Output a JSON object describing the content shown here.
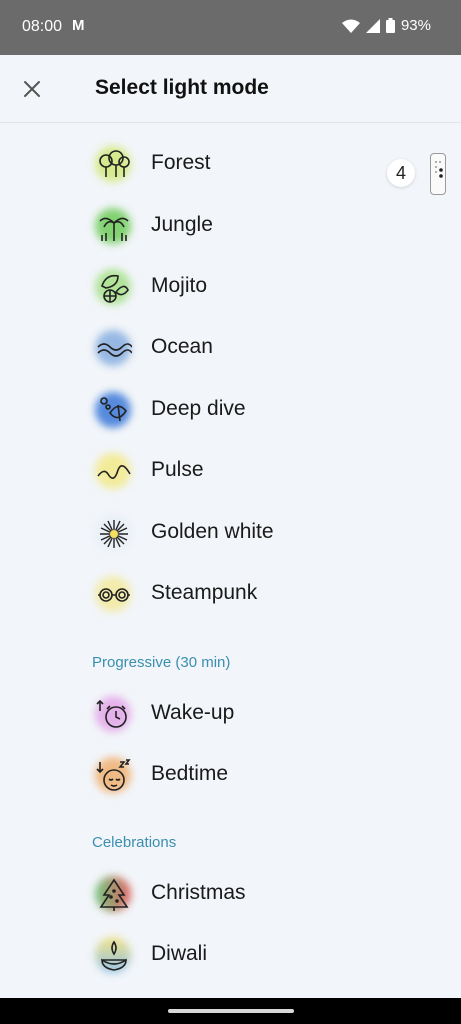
{
  "status_bar": {
    "time": "08:00",
    "carrier_glyph": "M",
    "battery": "93%"
  },
  "header": {
    "title": "Select light mode"
  },
  "modes": [
    {
      "label": "Forest",
      "icon": "forest-icon",
      "color": "#c6e07a"
    },
    {
      "label": "Jungle",
      "icon": "jungle-icon",
      "color": "#7fcf6e"
    },
    {
      "label": "Mojito",
      "icon": "mojito-icon",
      "color": "#a8e08a"
    },
    {
      "label": "Ocean",
      "icon": "ocean-icon",
      "color": "#7fa8e0"
    },
    {
      "label": "Deep dive",
      "icon": "deep-dive-icon",
      "color": "#3a78d8"
    },
    {
      "label": "Pulse",
      "icon": "pulse-icon",
      "color": "#f3e88a"
    },
    {
      "label": "Golden white",
      "icon": "golden-white-icon",
      "color": "#e8eef5"
    },
    {
      "label": "Steampunk",
      "icon": "steampunk-icon",
      "color": "#f3eaa0"
    }
  ],
  "progressive": {
    "header": "Progressive (30 min)",
    "items": [
      {
        "label": "Wake-up",
        "icon": "wake-up-icon",
        "color": "#e3a6e8"
      },
      {
        "label": "Bedtime",
        "icon": "bedtime-icon",
        "color": "#f0b070"
      }
    ]
  },
  "celebrations": {
    "header": "Celebrations",
    "items": [
      {
        "label": "Christmas",
        "icon": "christmas-icon",
        "color": "#e04848"
      },
      {
        "label": "Diwali",
        "icon": "diwali-icon",
        "color": "#f0d060"
      }
    ]
  },
  "forest_badge": "4",
  "accent_color": "#3a8fb0"
}
